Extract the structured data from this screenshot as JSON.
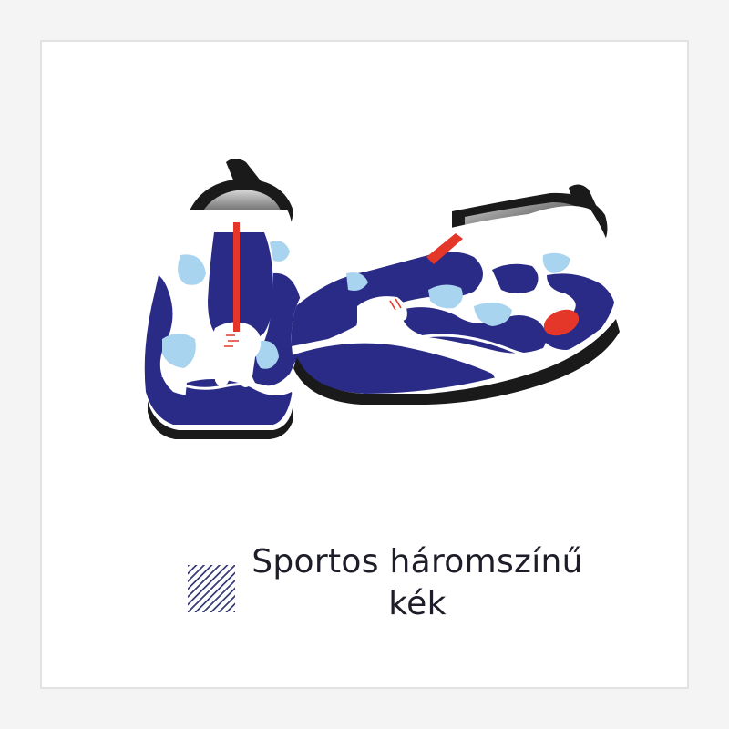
{
  "caption": {
    "line1": "Sportos háromszínű",
    "line2": "kék"
  },
  "colors": {
    "background": "#f4f4f4",
    "card": "#ffffff",
    "navy": "#2a2b86",
    "light_blue": "#a9d4ef",
    "red": "#e5362a",
    "black": "#1a1a1a"
  },
  "icons": {
    "swatch": "diagonal-hatch-swatch-icon"
  }
}
